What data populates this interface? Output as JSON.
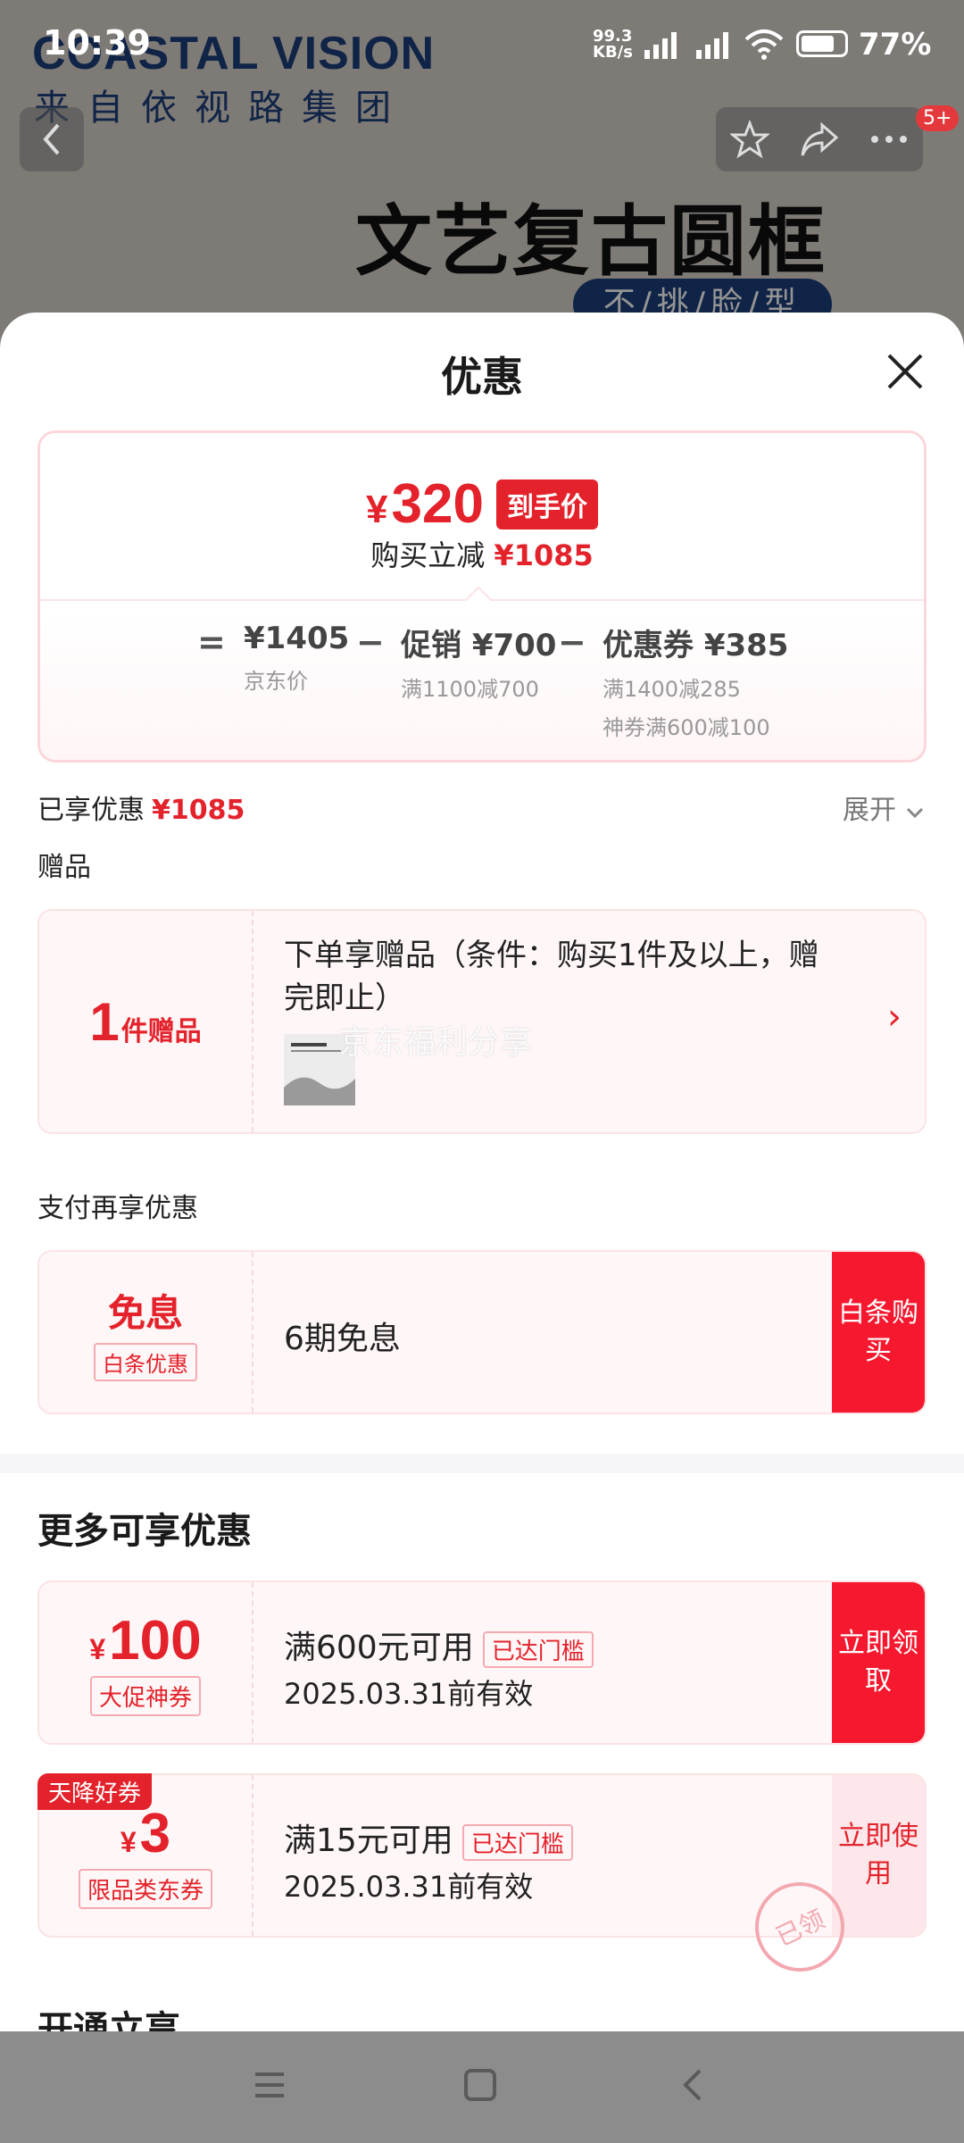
{
  "status_bar": {
    "time": "10:39",
    "network_speed_top": "99.3",
    "network_speed_bottom": "KB/s",
    "battery": "77%"
  },
  "background_page": {
    "brand_en": "COASTAL VISION",
    "brand_cn": "来自依视路集团",
    "promo_title": "文艺复古圆框",
    "promo_sub": "不/挑/脸/型",
    "badge": "5+"
  },
  "sheet": {
    "title": "优惠",
    "price": {
      "yen": "¥",
      "amount": "320",
      "tag": "到手价",
      "note": "购买立减",
      "note_value": "¥1085"
    },
    "formula": {
      "eq": "=",
      "minus": "−",
      "jd_price": "¥1405",
      "jd_label": "京东价",
      "promo": "促销 ¥700",
      "promo_sub": "满1100减700",
      "coupon": "优惠券 ¥385",
      "coupon_sub1": "满1400减285",
      "coupon_sub2": "神券满600减100"
    },
    "enjoyed_label": "已享优惠",
    "enjoyed_value": "¥1085",
    "expand": "展开",
    "gift_header": "赠品",
    "gift": {
      "count": "1",
      "unit": "件赠品",
      "text": "下单享赠品（条件：购买1件及以上，赠完即止）",
      "watermark": "京东福利分享"
    },
    "pay_header": "支付再享优惠",
    "pay": {
      "big": "免息",
      "tag": "白条优惠",
      "text": "6期免息",
      "button": "白条购买"
    },
    "more_header": "更多可享优惠",
    "coupons": [
      {
        "yen": "¥",
        "amount": "100",
        "tag": "大促神券",
        "title": "满600元可用",
        "badge": "已达门槛",
        "date": "2025.03.31前有效",
        "button": "立即领取"
      },
      {
        "corner": "天降好券",
        "yen": "¥",
        "amount": "3",
        "tag": "限品类东券",
        "title": "满15元可用",
        "badge": "已达门槛",
        "date": "2025.03.31前有效",
        "button": "立即使用",
        "stamp": "已领"
      }
    ],
    "open_header": "开通立享"
  }
}
